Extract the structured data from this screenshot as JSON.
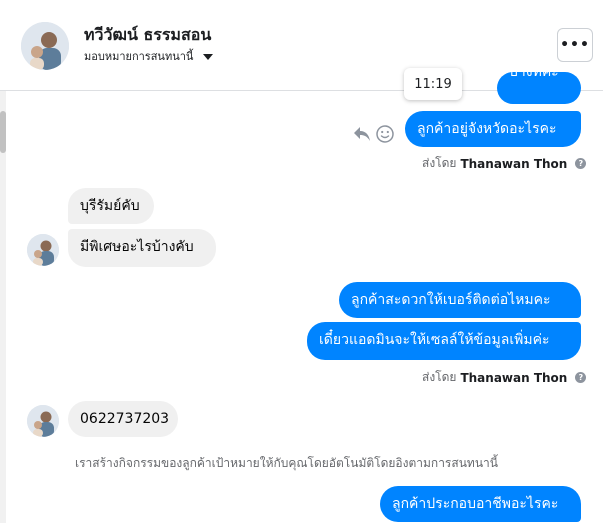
{
  "header": {
    "name": "ทวีวัฒน์ ธรรมสอน",
    "assign_label": "มอบหมายการสนทนานี้",
    "more_label": "•••"
  },
  "tooltip": {
    "time": "11:19"
  },
  "messages": {
    "out_partial": "บางที่ค่ะ",
    "out_1": "ลูกค้าอยู่จังหวัดอะไรคะ",
    "in_1": "บุรีรัมย์คับ",
    "in_2": "มีพิเศษอะไรบ้างคับ",
    "out_2": "ลูกค้าสะดวกให้เบอร์ติดต่อไหมคะ",
    "out_3": "เดี๋ยวแอดมินจะให้เซลล์ให้ข้อมูลเพิ่มค่ะ",
    "in_3": "0622737203",
    "out_4": "ลูกค้าประกอบอาชีพอะไรคะ"
  },
  "sent_by": {
    "prefix": "ส่งโดย",
    "name": "Thanawan Thon",
    "help": "?"
  },
  "notice": "เราสร้างกิจกรรมของลูกค้าเป้าหมายให้กับคุณโดยอัตโนมัติโดยอิงตามการสนทนานี้",
  "colors": {
    "outgoing": "#0084ff",
    "incoming": "#f0f0f0"
  },
  "icons": [
    "reply-icon",
    "emoji-icon",
    "caret-down-icon",
    "help-icon",
    "more-icon"
  ]
}
